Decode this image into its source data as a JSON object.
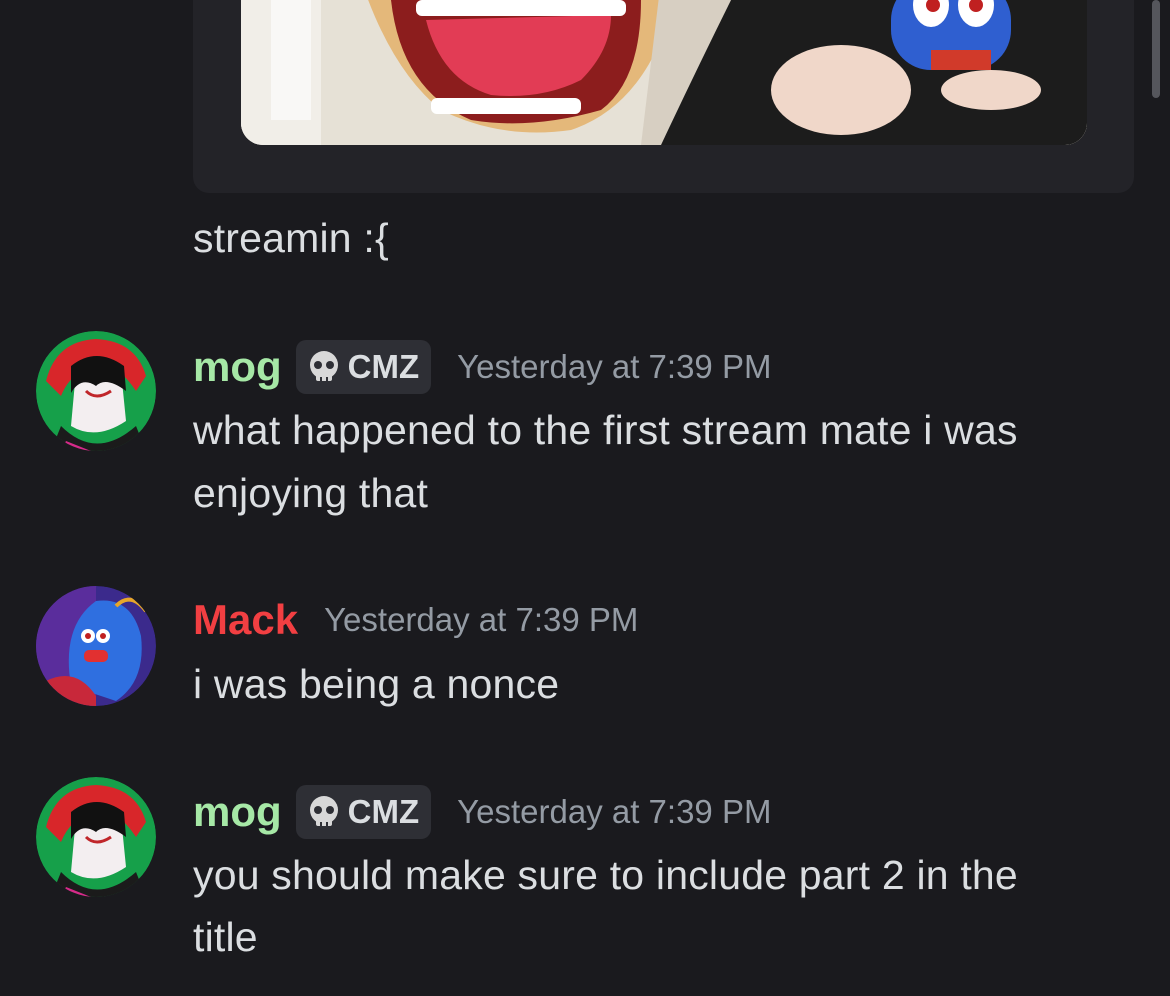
{
  "previous_message": {
    "embed_image": "thumbnail-image",
    "text": "streamin :{"
  },
  "messages": [
    {
      "author": "mog",
      "author_color": "#a6e8a6",
      "tag": {
        "icon": "skull-icon",
        "label": "CMZ"
      },
      "timestamp": "Yesterday at 7:39 PM",
      "lines": [
        "what happened to the first stream mate i was",
        "enjoying that"
      ]
    },
    {
      "author": "Mack",
      "author_color": "#f23f42",
      "timestamp": "Yesterday at 7:39 PM",
      "lines": [
        "i was being a nonce"
      ]
    },
    {
      "author": "mog",
      "author_color": "#a6e8a6",
      "tag": {
        "icon": "skull-icon",
        "label": "CMZ"
      },
      "timestamp": "Yesterday at 7:39 PM",
      "lines": [
        "you should make sure to include part 2 in the",
        "title"
      ]
    }
  ]
}
